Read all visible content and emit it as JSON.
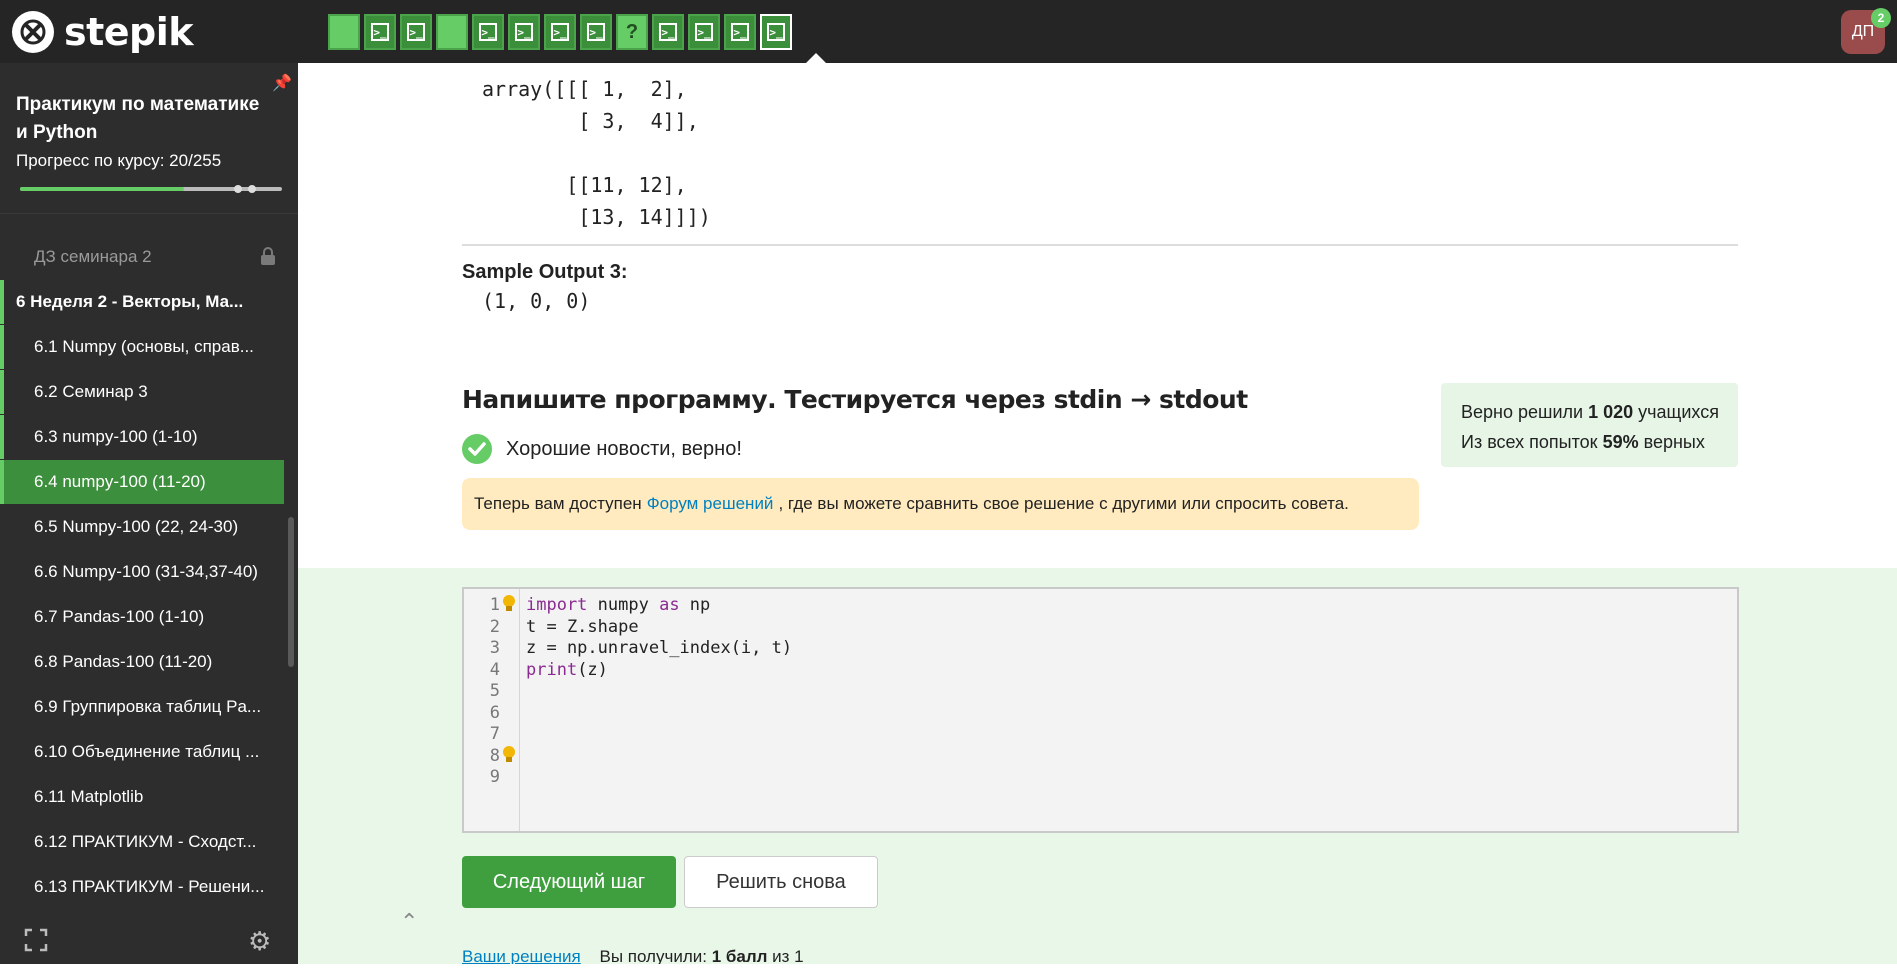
{
  "topbar": {
    "brand": "stepik",
    "steps": [
      {
        "kind": "plain",
        "state": "done"
      },
      {
        "kind": "code",
        "state": "done"
      },
      {
        "kind": "code",
        "state": "done"
      },
      {
        "kind": "plain",
        "state": "done"
      },
      {
        "kind": "code",
        "state": "done"
      },
      {
        "kind": "code",
        "state": "done"
      },
      {
        "kind": "code",
        "state": "done"
      },
      {
        "kind": "code",
        "state": "done"
      },
      {
        "kind": "quiz",
        "state": "done",
        "label": "?"
      },
      {
        "kind": "code",
        "state": "done"
      },
      {
        "kind": "code",
        "state": "done"
      },
      {
        "kind": "code",
        "state": "done"
      },
      {
        "kind": "code",
        "state": "current"
      }
    ],
    "avatar_initials": "ДП",
    "notification_count": "2"
  },
  "sidebar": {
    "course_title": "Практикум по математике и Python",
    "progress_label": "Прогресс по курсу:  20/255",
    "progress": {
      "done": 20,
      "total": 255
    },
    "items": [
      {
        "label": "ДЗ семинара 2",
        "style": "muted",
        "locked": true
      },
      {
        "label": "6  Неделя 2 - Векторы, Ма...",
        "style": "section"
      },
      {
        "label": "6.1  Numpy (основы, справ...",
        "style": "done"
      },
      {
        "label": "6.2  Семинар 3",
        "style": "done"
      },
      {
        "label": "6.3  numpy-100 (1-10)",
        "style": "done"
      },
      {
        "label": "6.4  numpy-100 (11-20)",
        "style": "active"
      },
      {
        "label": "6.5  Numpy-100 (22, 24-30)",
        "style": "normal"
      },
      {
        "label": "6.6  Numpy-100 (31-34,37-40)",
        "style": "normal"
      },
      {
        "label": "6.7  Pandas-100 (1-10)",
        "style": "normal"
      },
      {
        "label": "6.8  Pandas-100 (11-20)",
        "style": "normal"
      },
      {
        "label": "6.9  Группировка таблиц Pa...",
        "style": "normal"
      },
      {
        "label": "6.10  Объединение таблиц ...",
        "style": "normal"
      },
      {
        "label": "6.11  Matplotlib",
        "style": "normal"
      },
      {
        "label": "6.12  ПРАКТИКУМ - Сходст...",
        "style": "normal"
      },
      {
        "label": "6.13  ПРАКТИКУМ - Решени...",
        "style": "normal"
      }
    ]
  },
  "main": {
    "sample_input_tail": "array([[[ 1,  2],\n        [ 3,  4]],\n\n       [[11, 12],\n        [13, 14]]])",
    "sample_output_label": "Sample Output 3:",
    "sample_output_value": "(1, 0, 0)",
    "task_title": "Напишите программу. Тестируется через stdin → stdout",
    "success_message": "Хорошие новости, верно!",
    "forum": {
      "before": "Теперь вам доступен",
      "link": "Форум решений",
      "after": ", где вы можете сравнить свое решение с другими или спросить совета."
    },
    "stats": {
      "solved_prefix": "Верно решили",
      "solved_count": "1 020",
      "solved_suffix": "учащихся",
      "attempts_prefix": "Из всех попыток",
      "attempts_percent": "59%",
      "attempts_suffix": "верных"
    },
    "code_lines": [
      "import numpy as np",
      "t = Z.shape",
      "z = np.unravel_index(i, t)",
      "print(z)",
      "",
      "",
      "",
      "",
      ""
    ],
    "line_numbers": [
      "1",
      "2",
      "3",
      "4",
      "5",
      "6",
      "7",
      "8",
      "9"
    ],
    "buttons": {
      "next": "Следующий шаг",
      "retry": "Решить снова"
    },
    "footer": {
      "solutions_link": "Ваши решения",
      "score_prefix": "Вы получили:",
      "score_value": "1 балл",
      "score_suffix": "из 1"
    }
  },
  "colors": {
    "accent_green": "#66cc66",
    "active_green": "#3c8f3c",
    "link_blue": "#0080c0",
    "sidebar_bg": "#2d2d2d",
    "topbar_bg": "#252525"
  }
}
